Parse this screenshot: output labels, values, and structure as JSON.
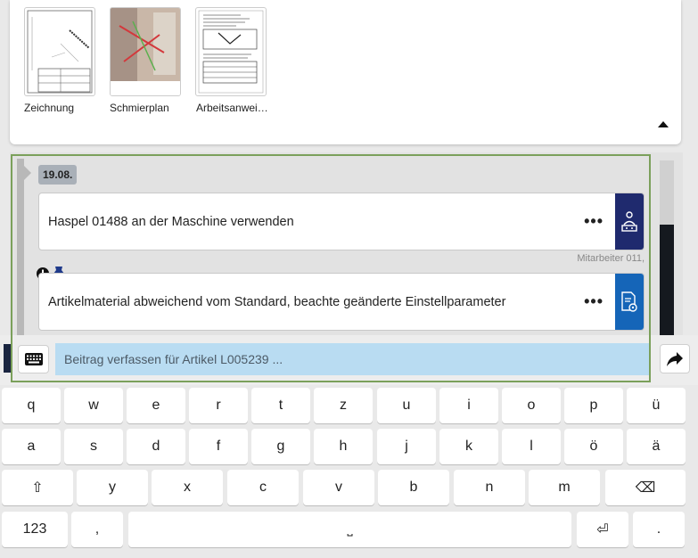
{
  "attachments": [
    {
      "label": "Zeichnung",
      "icon": "technical-drawing-thumbnail"
    },
    {
      "label": "Schmierplan",
      "icon": "lubrication-plan-photo-thumbnail"
    },
    {
      "label": "Arbeitsanwei…",
      "icon": "work-instruction-document-thumbnail"
    }
  ],
  "collapse_icon": "caret-up-icon",
  "feed": {
    "date": "19.08.",
    "posts": [
      {
        "text": "Haspel 01488 an der Maschine verwenden",
        "menu": "•••",
        "tile_color": "#1f2a6e",
        "icon": "worker-machine-icon"
      },
      {
        "text": "Artikelmaterial abweichend vom Standard, beachte geänderte Einstellparameter",
        "menu": "•••",
        "tile_color": "#1565b8",
        "icon": "article-settings-icon",
        "flags": [
          "alert-icon",
          "pin-icon"
        ]
      }
    ],
    "author": "Mitarbeiter 011,"
  },
  "composer": {
    "placeholder": "Beitrag verfassen für Artikel L005239 ...",
    "keyboard_toggle_icon": "keyboard-icon",
    "send_icon": "send-arrow-icon"
  },
  "keyboard": {
    "row1": [
      "q",
      "w",
      "e",
      "r",
      "t",
      "z",
      "u",
      "i",
      "o",
      "p",
      "ü"
    ],
    "row2": [
      "a",
      "s",
      "d",
      "f",
      "g",
      "h",
      "j",
      "k",
      "l",
      "ö",
      "ä"
    ],
    "row3": [
      "⇧",
      "y",
      "x",
      "c",
      "v",
      "b",
      "n",
      "m",
      "⌫"
    ],
    "row4": [
      "123",
      ",",
      "˽",
      "⏎",
      "."
    ]
  },
  "colors": {
    "accent_border": "#7ba05b",
    "input_bg": "#b9dcf2",
    "dark_tile": "#1f2a6e",
    "blue_tile": "#1565b8"
  }
}
